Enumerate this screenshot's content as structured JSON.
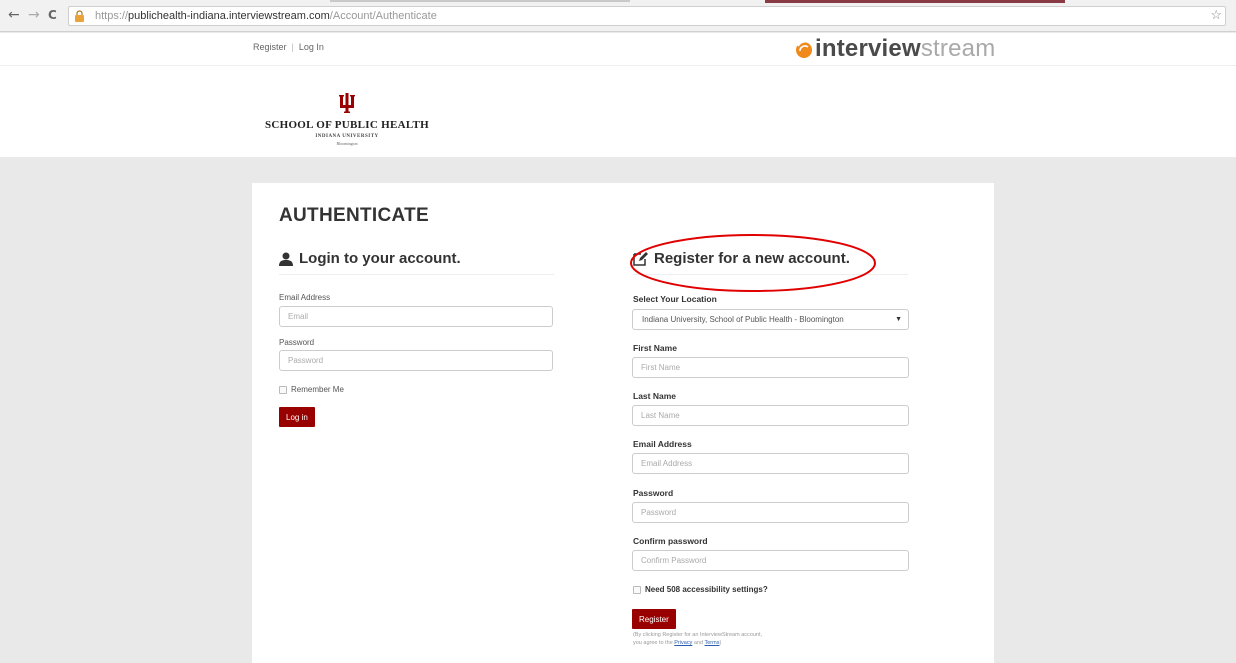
{
  "browser": {
    "url_scheme": "https://",
    "url_host": "publichealth-indiana.interviewstream.com",
    "url_path": "/Account/Authenticate",
    "back": "←",
    "forward": "→",
    "reload": "C",
    "star": "☆"
  },
  "header": {
    "nav_register": "Register",
    "nav_separator": "|",
    "nav_login": "Log In",
    "brand_bold": "interview",
    "brand_light": "stream",
    "school_name": "SCHOOL OF PUBLIC HEALTH",
    "school_university": "INDIANA UNIVERSITY",
    "school_city": "Bloomington"
  },
  "page": {
    "title": "AUTHENTICATE"
  },
  "login": {
    "heading": "Login to your account.",
    "email_label": "Email Address",
    "email_placeholder": "Email",
    "password_label": "Password",
    "password_placeholder": "Password",
    "remember_label": "Remember Me",
    "submit_label": "Log in"
  },
  "register": {
    "heading": "Register for a new account.",
    "location_label": "Select Your Location",
    "location_value": "Indiana University, School of Public Health - Bloomington",
    "first_name_label": "First Name",
    "first_name_placeholder": "First Name",
    "last_name_label": "Last Name",
    "last_name_placeholder": "Last Name",
    "email_label": "Email Address",
    "email_placeholder": "Email Address",
    "password_label": "Password",
    "password_placeholder": "Password",
    "confirm_label": "Confirm password",
    "confirm_placeholder": "Confirm Password",
    "accessibility_label": "Need 508 accessibility settings?",
    "submit_label": "Register",
    "legal_line1": "(By clicking Register for an InterviewStream account,",
    "legal_line2_prefix": "you agree to the",
    "privacy_link": "Privacy",
    "legal_and": "and",
    "terms_link": "Terms",
    "legal_close": ")"
  },
  "colors": {
    "accent": "#990000",
    "annotation": "#e00000",
    "brand_orange": "#f08a1c"
  }
}
